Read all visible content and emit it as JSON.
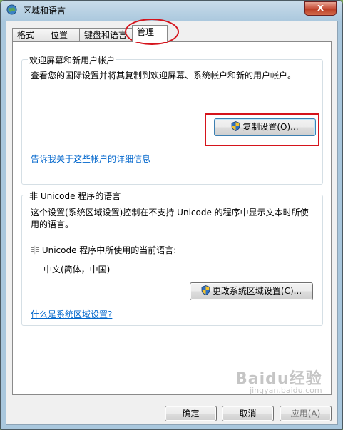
{
  "window": {
    "title": "区域和语言",
    "close_glyph": "x"
  },
  "tabs": [
    {
      "label": "格式"
    },
    {
      "label": "位置"
    },
    {
      "label": "键盘和语言"
    },
    {
      "label": "管理"
    }
  ],
  "welcome_group": {
    "label": "欢迎屏幕和新用户帐户",
    "description": "查看您的国际设置并将其复制到欢迎屏幕、系统帐户和新的用户帐户。",
    "copy_button": "复制设置(O)...",
    "link": "告诉我关于这些帐户的详细信息"
  },
  "unicode_group": {
    "label": "非 Unicode 程序的语言",
    "description_line1": "这个设置(系统区域设置)控制在不支持 Unicode 的程序中显示文本时所使",
    "description_line2": "用的语言。",
    "current_label": "非 Unicode 程序中所使用的当前语言:",
    "current_value": "中文(简体，中国)",
    "change_button": "更改系统区域设置(C)...",
    "link": "什么是系统区域设置?"
  },
  "footer": {
    "ok": "确定",
    "cancel": "取消",
    "apply": "应用(A)"
  },
  "watermark": {
    "brand": "Baidu经验",
    "sub": "jingyan.baidu.com"
  },
  "colors": {
    "link": "#0066cc",
    "highlight": "#d5141c"
  }
}
